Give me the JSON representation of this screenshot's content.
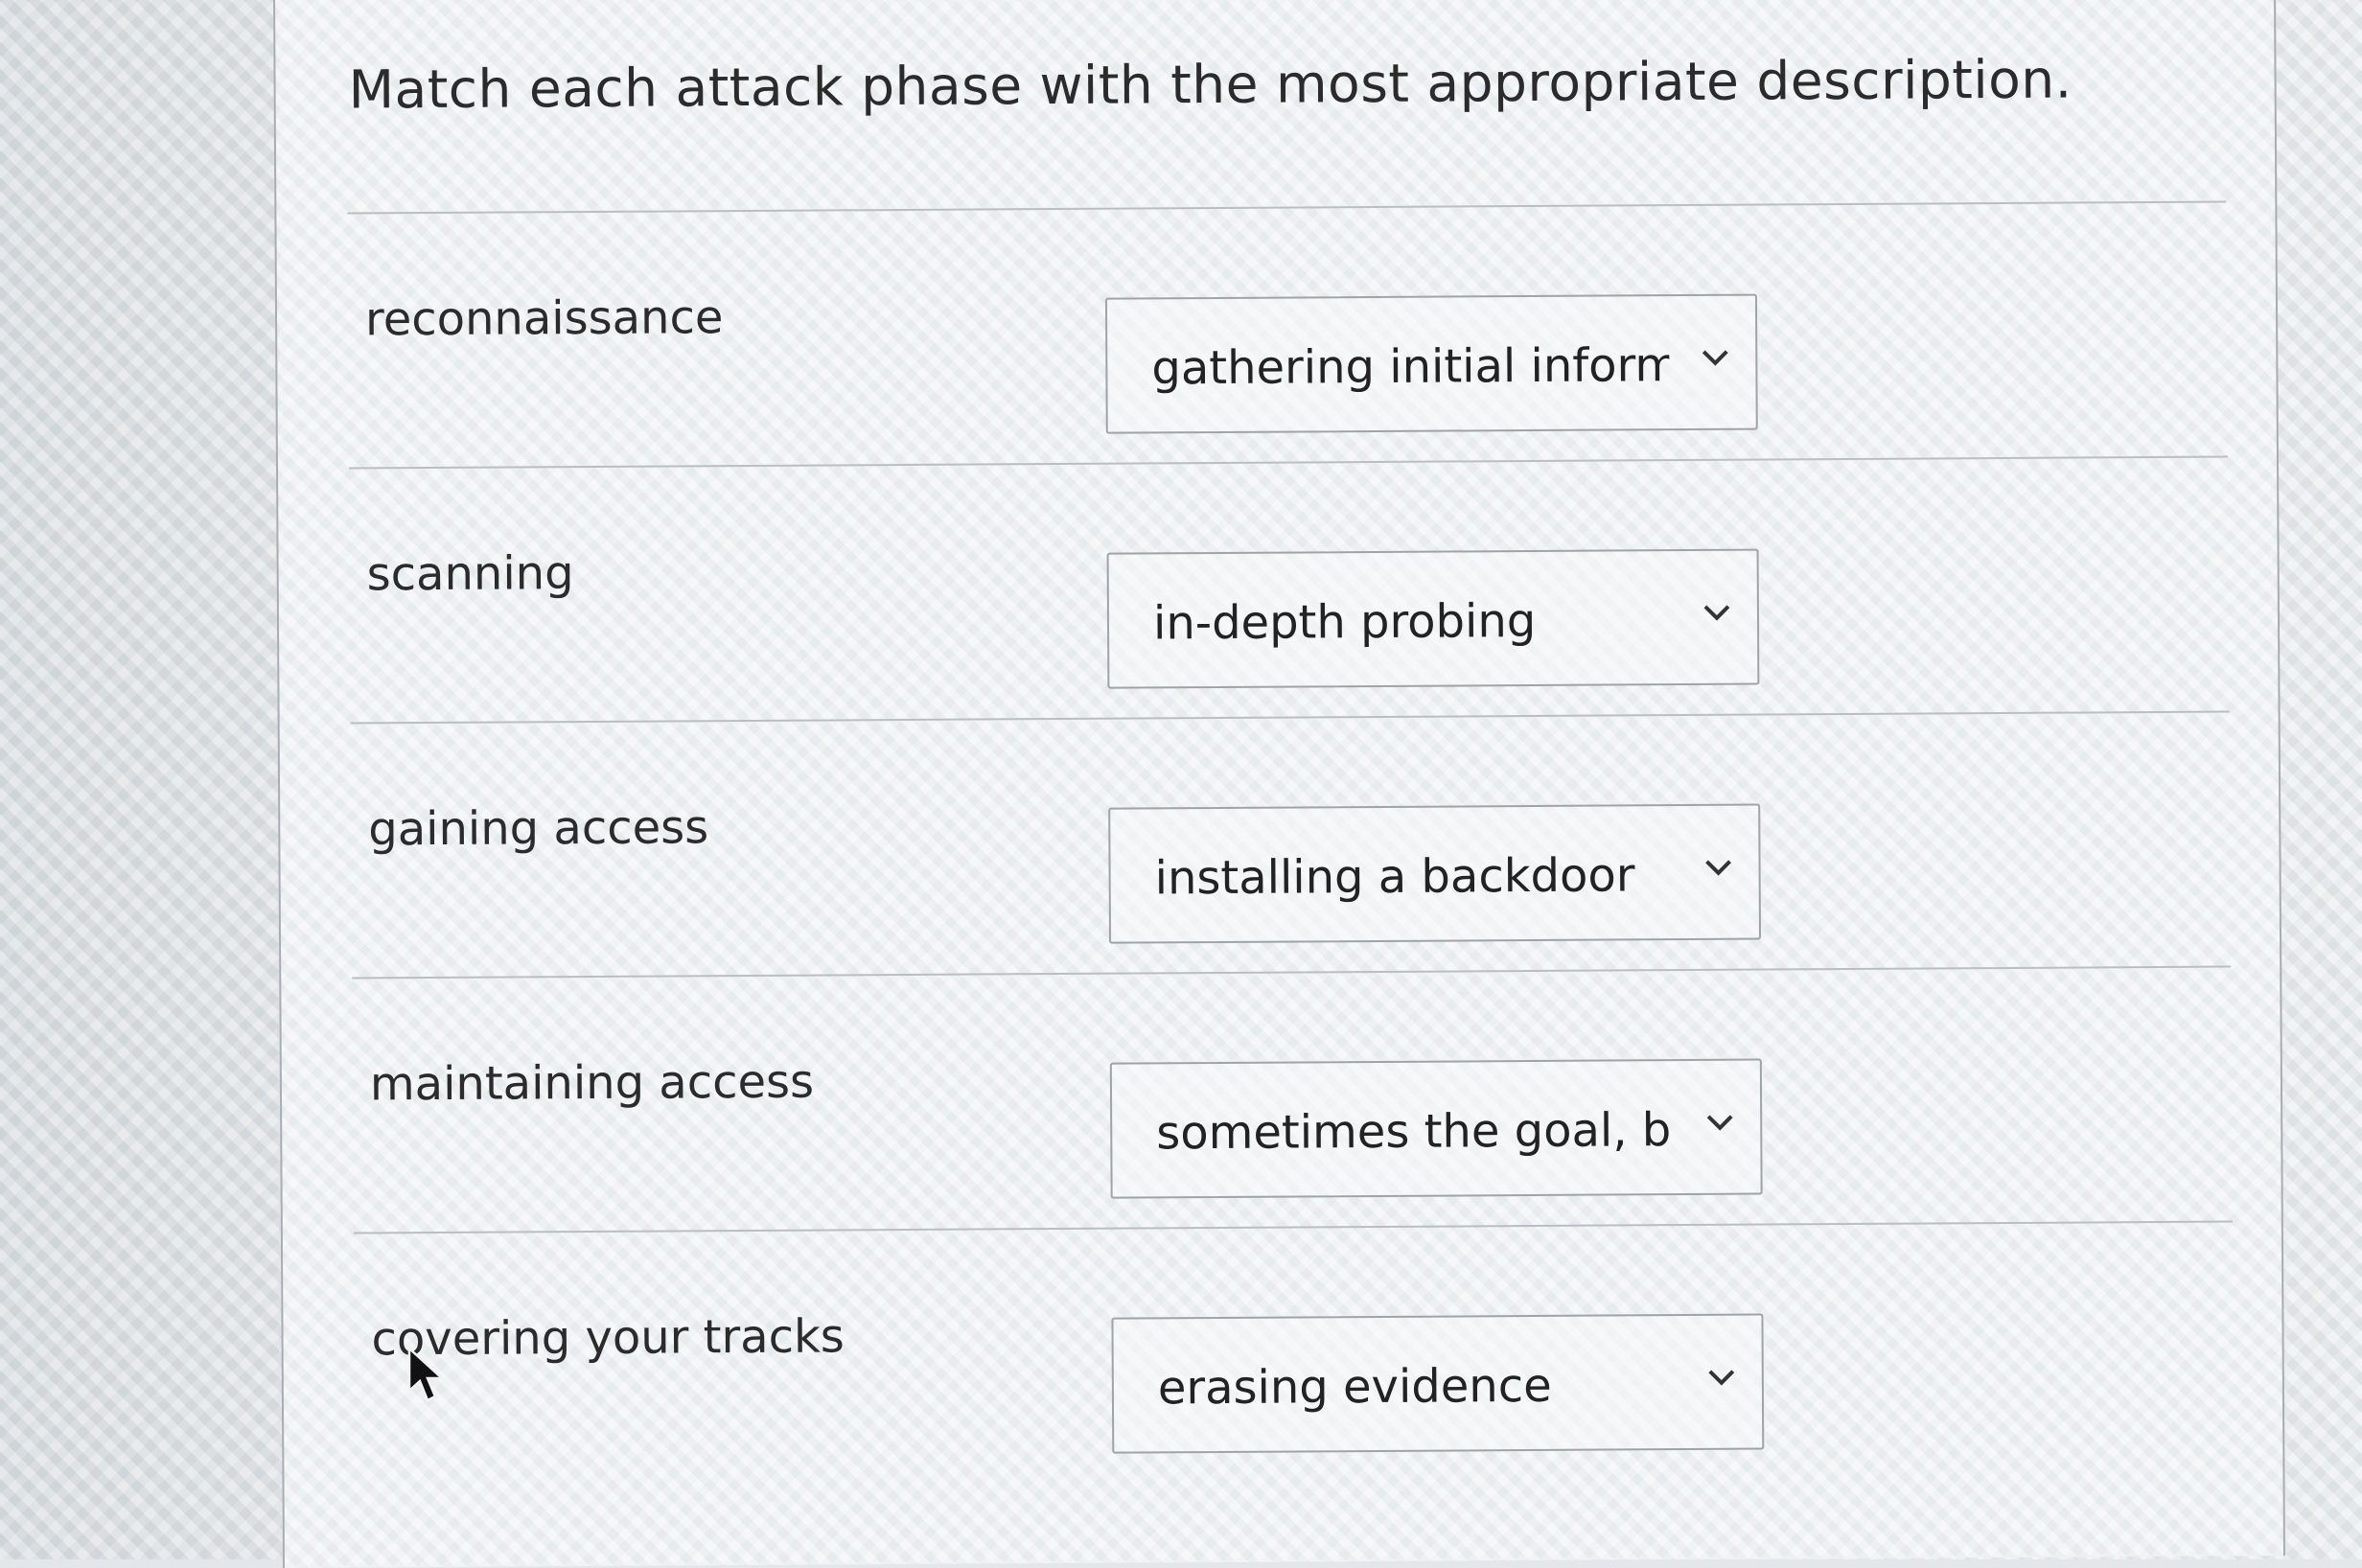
{
  "question": "Match each attack phase with the most appropriate description.",
  "rows": [
    {
      "term": "reconnaissance",
      "selected": "gathering initial informa"
    },
    {
      "term": "scanning",
      "selected": "in-depth probing"
    },
    {
      "term": "gaining access",
      "selected": "installing a backdoor"
    },
    {
      "term": "maintaining access",
      "selected": "sometimes the goal, but"
    },
    {
      "term": "covering your tracks",
      "selected": "erasing evidence"
    }
  ]
}
